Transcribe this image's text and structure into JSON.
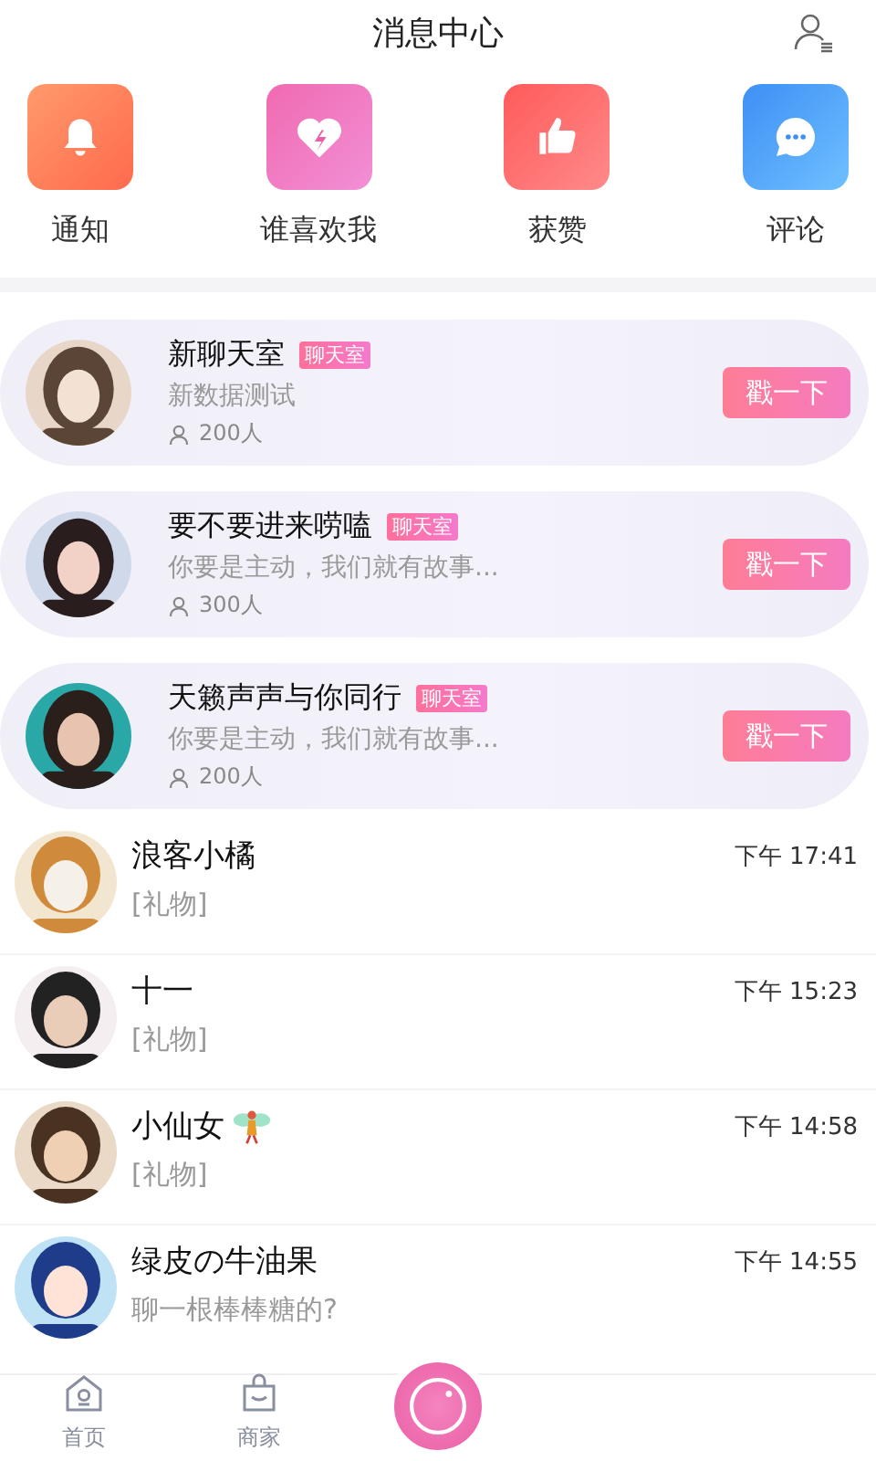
{
  "header": {
    "title": "消息中心"
  },
  "shortcuts": [
    {
      "label": "通知",
      "kind": "bell"
    },
    {
      "label": "谁喜欢我",
      "kind": "heart"
    },
    {
      "label": "获赞",
      "kind": "thumb"
    },
    {
      "label": "评论",
      "kind": "comment"
    }
  ],
  "rooms": [
    {
      "name": "新聊天室",
      "tag": "聊天室",
      "subtitle": "新数据测试",
      "members": "200人",
      "button": "戳一下"
    },
    {
      "name": "要不要进来唠嗑",
      "tag": "聊天室",
      "subtitle": "你要是主动，我们就有故事...",
      "members": "300人",
      "button": "戳一下"
    },
    {
      "name": "天籁声声与你同行",
      "tag": "聊天室",
      "subtitle": "你要是主动，我们就有故事...",
      "members": "200人",
      "button": "戳一下"
    }
  ],
  "conversations": [
    {
      "name": "浪客小橘",
      "time": "下午 17:41",
      "preview": "[礼物]"
    },
    {
      "name": "十一",
      "time": "下午 15:23",
      "preview": "[礼物]"
    },
    {
      "name": "小仙女",
      "fairy_badge": true,
      "time": "下午 14:58",
      "preview": "[礼物]"
    },
    {
      "name": "绿皮の牛油果",
      "time": "下午 14:55",
      "preview": "聊一根棒棒糖的?"
    }
  ],
  "tabbar": [
    {
      "label": "首页",
      "kind": "home",
      "selected": false
    },
    {
      "label": "商家",
      "kind": "shop",
      "selected": false
    }
  ]
}
